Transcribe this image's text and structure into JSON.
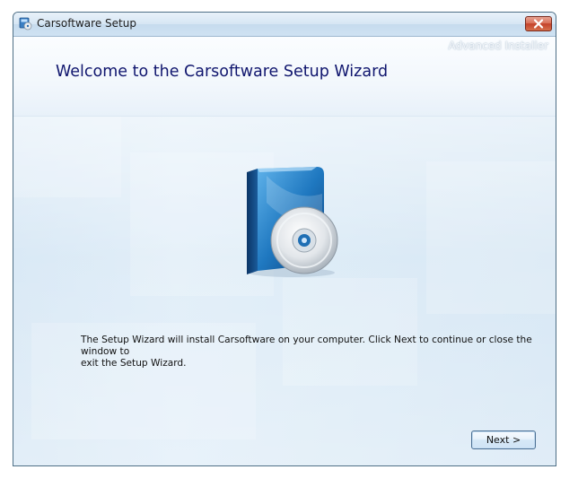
{
  "window": {
    "title": "Carsoftware Setup",
    "close_label": "Close"
  },
  "header": {
    "brand": "Advanced Installer",
    "title": "Welcome to the Carsoftware Setup Wizard"
  },
  "main": {
    "intro_line1": "The Setup Wizard will install Carsoftware on your computer. Click Next to continue or close the window to",
    "intro_line2": "exit the Setup Wizard."
  },
  "buttons": {
    "next_label": "Next >"
  },
  "icons": {
    "app": "installer-app-icon",
    "close": "close-icon",
    "product": "software-box-cd-icon"
  },
  "colors": {
    "title_text": "#10166e",
    "close_button": "#c4412a",
    "background": "#cfe3f3"
  }
}
